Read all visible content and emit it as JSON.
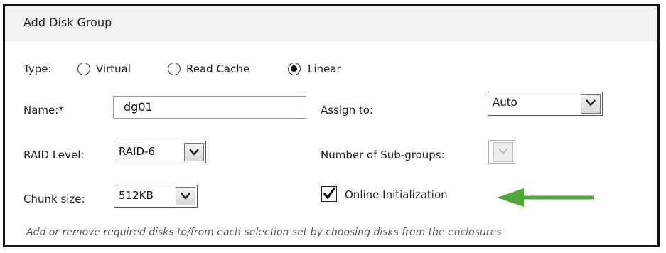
{
  "dialog": {
    "title": "Add Disk Group"
  },
  "type_row": {
    "label": "Type:",
    "options": [
      {
        "label": "Virtual",
        "selected": false
      },
      {
        "label": "Read Cache",
        "selected": false
      },
      {
        "label": "Linear",
        "selected": true
      }
    ]
  },
  "name_field": {
    "label": "Name:*",
    "value": "dg01"
  },
  "assign_to": {
    "label": "Assign to:",
    "value": "Auto"
  },
  "raid_level": {
    "label": "RAID Level:",
    "value": "RAID-6"
  },
  "sub_groups": {
    "label": "Number of Sub-groups:",
    "value": ""
  },
  "chunk_size": {
    "label": "Chunk size:",
    "value": "512KB"
  },
  "online_init": {
    "label": "Online Initialization",
    "checked": true
  },
  "hint_text": "Add or remove required disks to/from each selection set by choosing disks from the enclosures",
  "colors": {
    "arrow": "#4ea83a",
    "title_bar": "#f2f2f2",
    "border": "#111111"
  },
  "icons": [
    "radio-button",
    "chevron-down-icon",
    "checkmark-icon",
    "arrow-left-icon"
  ]
}
